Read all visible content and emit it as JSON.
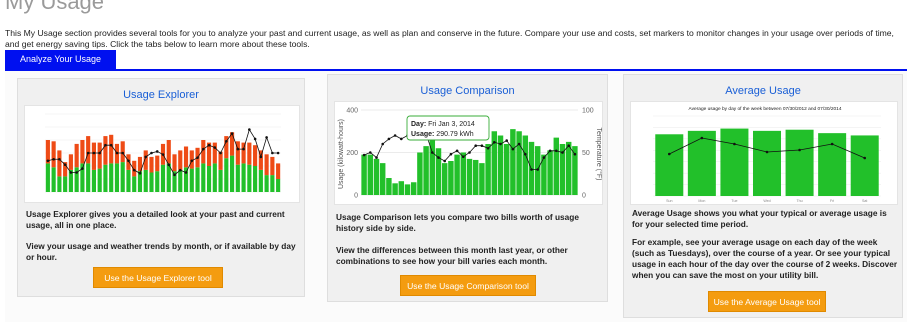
{
  "page": {
    "title": "My Usage",
    "intro": "This My Usage section provides several tools for you to analyze your past and current usage, as well as plan and conserve in the future. Compare your use and costs, set markers to monitor changes in your usage over periods of time, and get energy saving tips. Click the tabs below to learn more about these tools.",
    "active_tab": "Analyze Your Usage"
  },
  "colors": {
    "accent": "#0010f0",
    "button": "#f49c10",
    "title_link": "#1a5fd6",
    "bar_green": "#22c02a",
    "bar_red": "#ee4b16"
  },
  "cards": [
    {
      "title": "Usage Explorer",
      "text1": "Usage Explorer gives you a detailed look at your past and current usage, all in one place.",
      "text2": "View your usage and weather trends by month, or if available by day or hour.",
      "button": "Use the Usage Explorer tool"
    },
    {
      "title": "Usage Comparison",
      "text1": "Usage Comparison lets you compare two bills worth of usage history side by side.",
      "text2": "View the differences between this month last year, or other combinations to see how your bill varies each month.",
      "button": "Use the Usage Comparison tool",
      "tooltip": {
        "day_label": "Day:",
        "day_value": "Fri Jan 3, 2014",
        "usage_label": "Usage:",
        "usage_value": "290.79 kWh"
      },
      "axis": {
        "ylabel": "Usage (kilowatt-hours)",
        "y2label": "Temperature (°F)",
        "y_ticks": [
          "400",
          "200",
          "0"
        ],
        "y2_ticks": [
          "100",
          "50",
          "0"
        ]
      }
    },
    {
      "title": "Average Usage",
      "text1": "Average Usage shows you what your typical or average usage is for your selected time period.",
      "text2": "For example, see your average usage on each day of the week (such as Tuesdays), over the course of a year. Or see your typical usage in each hour of the day over the course of 2 weeks. Discover when you can save the most on your utility bill.",
      "button": "Use the Average Usage tool",
      "chart_title": "Average usage by day of the week between 07/30/2012 and 07/30/2014"
    }
  ],
  "chart_data": [
    {
      "type": "bar",
      "title": "",
      "ylim": [
        0,
        300
      ],
      "y2lim": [
        0,
        100
      ],
      "stacked": true,
      "series": [
        {
          "values": [
            110,
            95,
            60,
            60,
            85,
            95,
            110,
            110,
            85,
            90,
            105,
            110,
            110,
            115,
            85,
            60,
            80,
            85,
            75,
            80,
            105,
            110,
            80,
            85,
            95,
            90,
            95,
            110,
            100,
            110,
            85,
            130,
            140,
            105,
            110,
            105,
            100,
            85,
            65,
            65,
            50
          ]
        },
        {
          "values": [
            90,
            100,
            100,
            55,
            60,
            90,
            90,
            105,
            105,
            100,
            110,
            110,
            75,
            80,
            60,
            60,
            55,
            75,
            60,
            60,
            80,
            90,
            65,
            75,
            80,
            70,
            75,
            90,
            90,
            80,
            70,
            85,
            90,
            90,
            80,
            85,
            80,
            75,
            80,
            70,
            60
          ]
        }
      ],
      "line": [
        40,
        42,
        42,
        35,
        25,
        25,
        30,
        50,
        50,
        50,
        60,
        60,
        50,
        50,
        40,
        28,
        24,
        45,
        50,
        52,
        48,
        35,
        22,
        28,
        25,
        40,
        44,
        55,
        60,
        57,
        50,
        65,
        75,
        55,
        55,
        80,
        68,
        45,
        70,
        50,
        50
      ]
    },
    {
      "type": "bar",
      "ylim": [
        0,
        400
      ],
      "y2lim": [
        0,
        100
      ],
      "series": [
        {
          "values": [
            190,
            190,
            170,
            150,
            80,
            55,
            65,
            50,
            60,
            200,
            230,
            270,
            220,
            150,
            160,
            190,
            200,
            170,
            165,
            150,
            240,
            300,
            280,
            240,
            310,
            300,
            280,
            250,
            230,
            190,
            210,
            270,
            240,
            250,
            230
          ]
        }
      ],
      "line": [
        47,
        50,
        44,
        60,
        66,
        70,
        66,
        70,
        68,
        75,
        72,
        50,
        44,
        40,
        48,
        52,
        45,
        50,
        58,
        58,
        55,
        62,
        60,
        64,
        54,
        60,
        48,
        30,
        30,
        44,
        52,
        52,
        50,
        58,
        48
      ]
    },
    {
      "type": "bar",
      "title": "Average usage by day of the week between 07/30/2012 and 07/30/2014",
      "ylim": [
        0,
        70
      ],
      "y2lim": [
        0,
        80
      ],
      "categories": [
        "Sun",
        "Mon",
        "Tue",
        "Wed",
        "Thu",
        "Fri",
        "Sat"
      ],
      "series": [
        {
          "values": [
            54,
            57,
            59,
            57,
            58,
            55,
            53
          ]
        }
      ],
      "line": [
        42,
        58,
        52,
        44,
        46,
        52,
        38
      ]
    }
  ]
}
